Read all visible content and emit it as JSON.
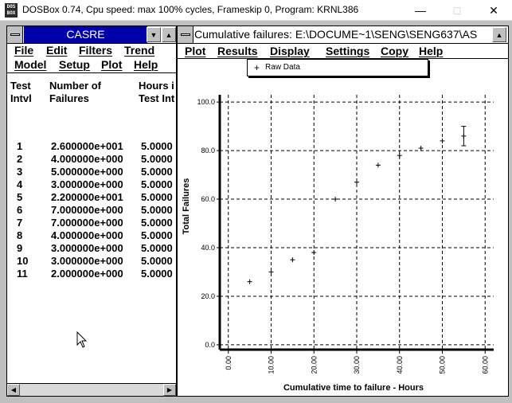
{
  "os_window": {
    "icon_text": "DOS BOX",
    "title": "DOSBox 0.74, Cpu speed: max 100% cycles, Frameskip  0, Program:  KRNL386",
    "minimize": "—",
    "maximize": "□",
    "close": "✕"
  },
  "casre_window": {
    "title": "CASRE",
    "title_bg": "#0000a8",
    "menu_row1": [
      "File",
      "Edit",
      "Filters",
      "Trend"
    ],
    "menu_row2": [
      "Model",
      "Setup",
      "Plot",
      "Help"
    ],
    "columns": [
      {
        "line1": "Test",
        "line2": "Intvl"
      },
      {
        "line1": "Number of",
        "line2": "Failures"
      },
      {
        "line1": "Hours i",
        "line2": "Test Int"
      }
    ],
    "rows": [
      {
        "intvl": "1",
        "failures": "2.600000e+001",
        "hours": "5.0000"
      },
      {
        "intvl": "2",
        "failures": "4.000000e+000",
        "hours": "5.0000"
      },
      {
        "intvl": "3",
        "failures": "5.000000e+000",
        "hours": "5.0000"
      },
      {
        "intvl": "4",
        "failures": "3.000000e+000",
        "hours": "5.0000"
      },
      {
        "intvl": "5",
        "failures": "2.200000e+001",
        "hours": "5.0000"
      },
      {
        "intvl": "6",
        "failures": "7.000000e+000",
        "hours": "5.0000"
      },
      {
        "intvl": "7",
        "failures": "7.000000e+000",
        "hours": "5.0000"
      },
      {
        "intvl": "8",
        "failures": "4.000000e+000",
        "hours": "5.0000"
      },
      {
        "intvl": "9",
        "failures": "3.000000e+000",
        "hours": "5.0000"
      },
      {
        "intvl": "10",
        "failures": "3.000000e+000",
        "hours": "5.0000"
      },
      {
        "intvl": "11",
        "failures": "2.000000e+000",
        "hours": "5.0000"
      }
    ]
  },
  "plot_window": {
    "title": "Cumulative failures:   E:\\DOCUME~1\\SENG\\SENG637\\AS",
    "menu": [
      "Plot",
      "Results",
      "Display",
      "Settings",
      "Copy",
      "Help"
    ],
    "legend_symbol": "+",
    "legend_label": "Raw Data"
  },
  "chart_data": {
    "type": "scatter",
    "title": "",
    "xlabel": "Cumulative time to failure - Hours",
    "ylabel": "Total Failures",
    "xlim": [
      -2,
      62
    ],
    "ylim": [
      -2,
      103
    ],
    "x_ticks": [
      0,
      10,
      20,
      30,
      40,
      50,
      60
    ],
    "x_tick_labels": [
      "0.00",
      "10.00",
      "20.00",
      "30.00",
      "40.00",
      "50.00",
      "60.00"
    ],
    "y_ticks": [
      0,
      20,
      40,
      60,
      80,
      100
    ],
    "y_tick_labels": [
      "0.0",
      "20.0",
      "40.0",
      "60.0",
      "80.0",
      "100.0"
    ],
    "grid": true,
    "legend_position": "top-left",
    "series": [
      {
        "name": "Raw Data",
        "x": [
          5,
          10,
          15,
          20,
          25,
          30,
          35,
          40,
          45,
          50,
          55
        ],
        "y": [
          26,
          30,
          35,
          38,
          60,
          67,
          74,
          78,
          81,
          84,
          86
        ],
        "error_high": [
          0,
          0,
          0,
          0,
          0,
          0,
          0,
          0,
          0,
          0,
          90
        ],
        "error_low": [
          0,
          0,
          0,
          0,
          0,
          0,
          0,
          0,
          0,
          0,
          82
        ]
      }
    ]
  }
}
